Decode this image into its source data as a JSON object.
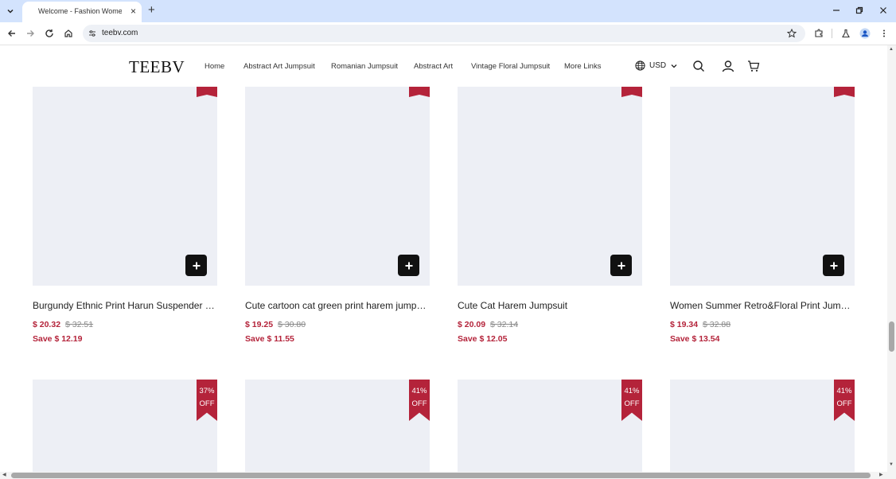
{
  "browser": {
    "tab_title": "Welcome - Fashion Women Clothing",
    "tab_close": "×",
    "new_tab": "+",
    "url": "teebv.com"
  },
  "site": {
    "logo": "TEEBV",
    "nav": [
      {
        "label": "Home"
      },
      {
        "label": "Abstract Art Jumpsuit"
      },
      {
        "label": "Romanian Jumpsuit"
      },
      {
        "label": "Abstract Art"
      },
      {
        "label": "Vintage Floral Jumpsuit"
      },
      {
        "label": "More Links"
      }
    ],
    "currency": "USD",
    "icons": [
      "globe-icon",
      "chevron-down-icon",
      "search-icon",
      "account-icon",
      "cart-icon"
    ]
  },
  "products_row1": [
    {
      "title": "Burgundy Ethnic Print Harun Suspender Jumpsuit",
      "price": "$ 20.32",
      "old_price": "$ 32.51",
      "save": "Save $ 12.19"
    },
    {
      "title": "Cute cartoon cat green print harem jumpsuit",
      "price": "$ 19.25",
      "old_price": "$ 30.80",
      "save": "Save $ 11.55"
    },
    {
      "title": "Cute Cat Harem Jumpsuit",
      "price": "$ 20.09",
      "old_price": "$ 32.14",
      "save": "Save $ 12.05"
    },
    {
      "title": "Women Summer Retro&Floral Print Jumpsuit",
      "price": "$ 19.34",
      "old_price": "$ 32.88",
      "save": "Save $ 13.54"
    }
  ],
  "products_row2": [
    {
      "badge_pct": "37%",
      "badge_off": "OFF"
    },
    {
      "badge_pct": "41%",
      "badge_off": "OFF"
    },
    {
      "badge_pct": "41%",
      "badge_off": "OFF"
    },
    {
      "badge_pct": "41%",
      "badge_off": "OFF"
    }
  ],
  "colors": {
    "accent": "#b4233a",
    "image_placeholder": "#edeff5",
    "chrome_tabstrip": "#d3e3fd"
  }
}
